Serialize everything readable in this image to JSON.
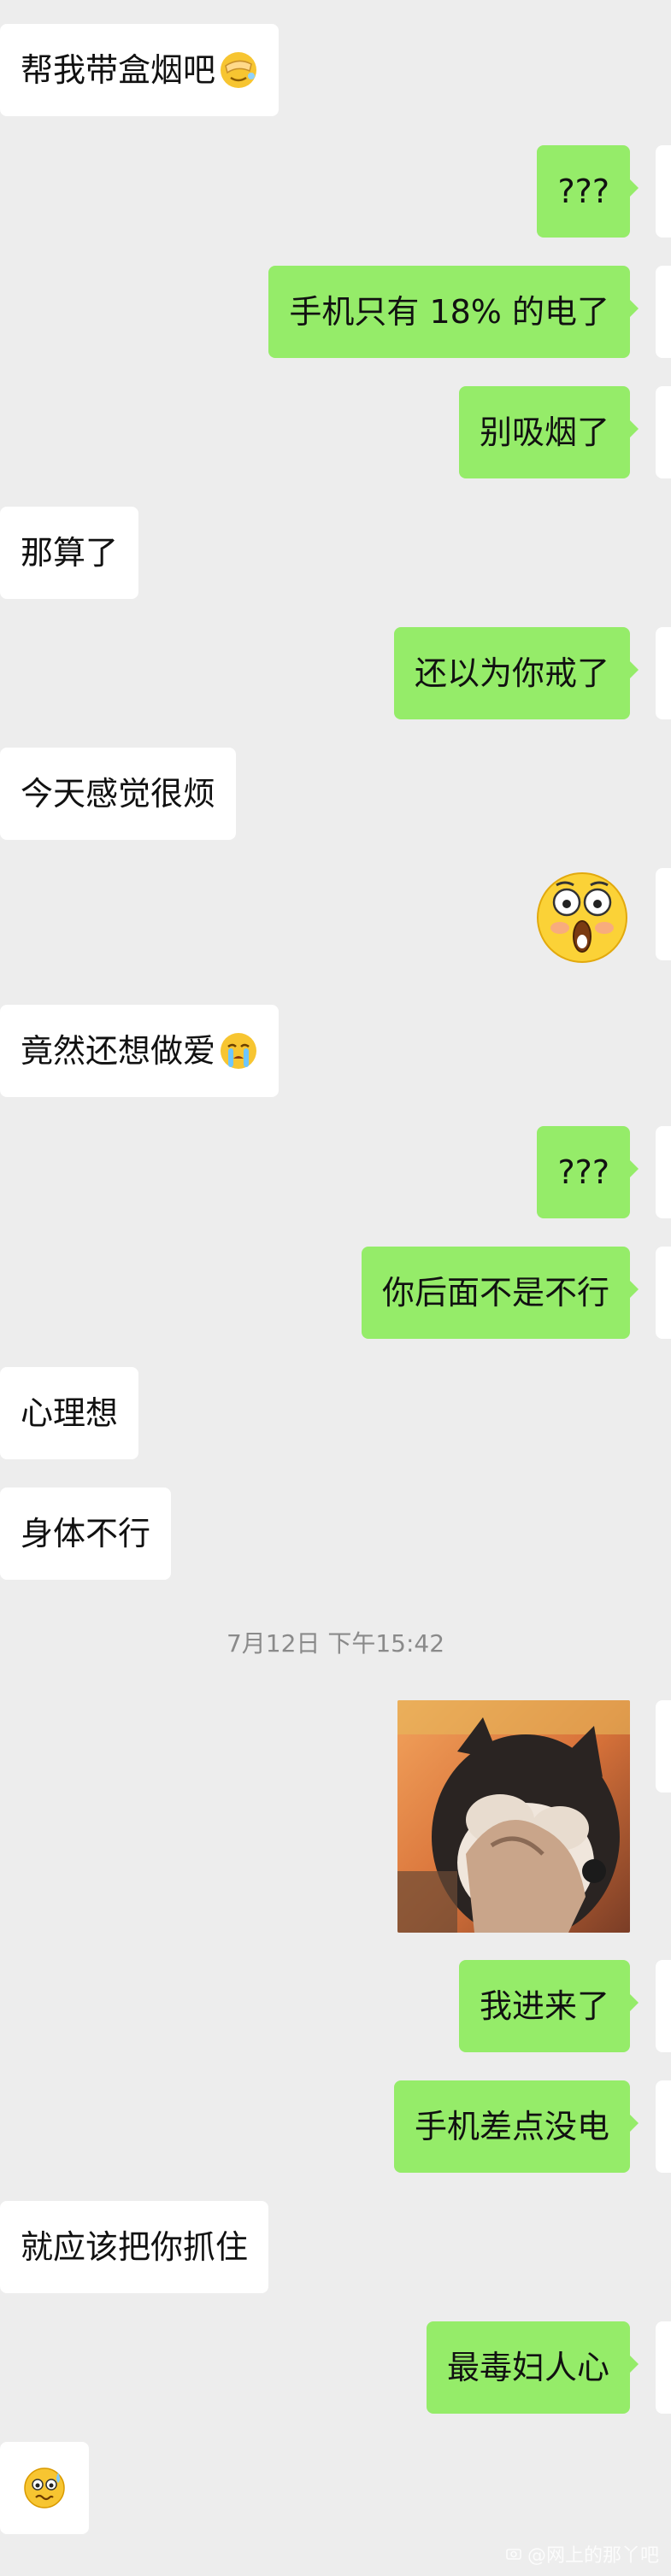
{
  "messages": [
    {
      "side": "in",
      "text": "帮我带盒烟吧",
      "emoji": "face-palm-emoji"
    },
    {
      "side": "out",
      "text": "???"
    },
    {
      "side": "out",
      "text": "手机只有 18% 的电了"
    },
    {
      "side": "out",
      "text": "别吸烟了"
    },
    {
      "side": "in",
      "text": "那算了"
    },
    {
      "side": "out",
      "text": "还以为你戒了"
    },
    {
      "side": "in",
      "text": "今天感觉很烦"
    },
    {
      "side": "out",
      "sticker": "shocked-face-sticker"
    },
    {
      "side": "in",
      "text": "竟然还想做爱",
      "emoji": "crying-emoji"
    },
    {
      "side": "out",
      "text": "???"
    },
    {
      "side": "out",
      "text": "你后面不是不行"
    },
    {
      "side": "in",
      "text": "心理想"
    },
    {
      "side": "in",
      "text": "身体不行"
    },
    {
      "side": "out",
      "image": "dog-covering-face-photo"
    },
    {
      "side": "out",
      "text": "我进来了"
    },
    {
      "side": "out",
      "text": "手机差点没电"
    },
    {
      "side": "in",
      "text": "就应该把你抓住"
    },
    {
      "side": "out",
      "text": "最毒妇人心"
    },
    {
      "side": "in",
      "sticker": "nervous-sweat-emoji"
    }
  ],
  "timestamp": "7月12日 下午15:42",
  "watermark": "@网上的那丫吧",
  "colors": {
    "background": "#ededed",
    "incoming": "#ffffff",
    "outgoing": "#95ec69",
    "timestamp": "#8a8a8a"
  }
}
